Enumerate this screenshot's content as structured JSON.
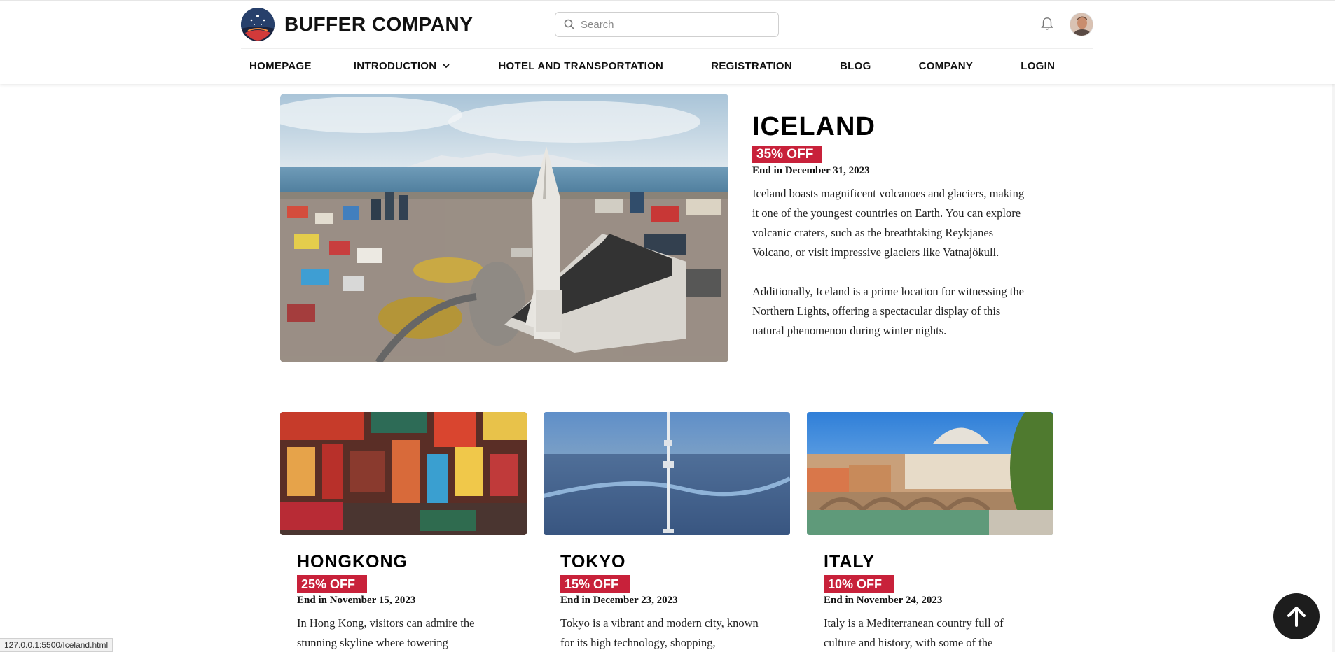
{
  "header": {
    "brand": "BUFFER COMPANY",
    "search_placeholder": "Search",
    "nav": [
      "HOMEPAGE",
      "INTRODUCTION",
      "HOTEL AND TRANSPORTATION",
      "REGISTRATION",
      "BLOG",
      "COMPANY",
      "LOGIN"
    ]
  },
  "feature": {
    "title": "ICELAND",
    "discount": "35% OFF",
    "end": "End in December 31, 2023",
    "para1": "Iceland boasts magnificent volcanoes and glaciers, making it one of the youngest countries on Earth. You can explore volcanic craters, such as the breathtaking Reykjanes Volcano, or visit impressive glaciers like Vatnajökull.",
    "para2": "Additionally, Iceland is a prime location for witnessing the Northern Lights, offering a spectacular display of this natural phenomenon during winter nights."
  },
  "cards": [
    {
      "title": "HONGKONG",
      "discount": "25% OFF",
      "end": "End in November 15, 2023",
      "para": "In Hong Kong, visitors can admire the stunning skyline where towering"
    },
    {
      "title": "TOKYO",
      "discount": "15% OFF",
      "end": "End in December 23, 2023",
      "para": "Tokyo is a vibrant and modern city, known for its high technology, shopping,"
    },
    {
      "title": "ITALY",
      "discount": "10% OFF",
      "end": "End in November 24, 2023",
      "para": "Italy is a Mediterranean country full of culture and history, with some of the"
    }
  ],
  "statusbar": "127.0.0.1:5500/Iceland.html",
  "colors": {
    "badge": "#c8213a",
    "scrolltop": "#1d1d1d"
  }
}
